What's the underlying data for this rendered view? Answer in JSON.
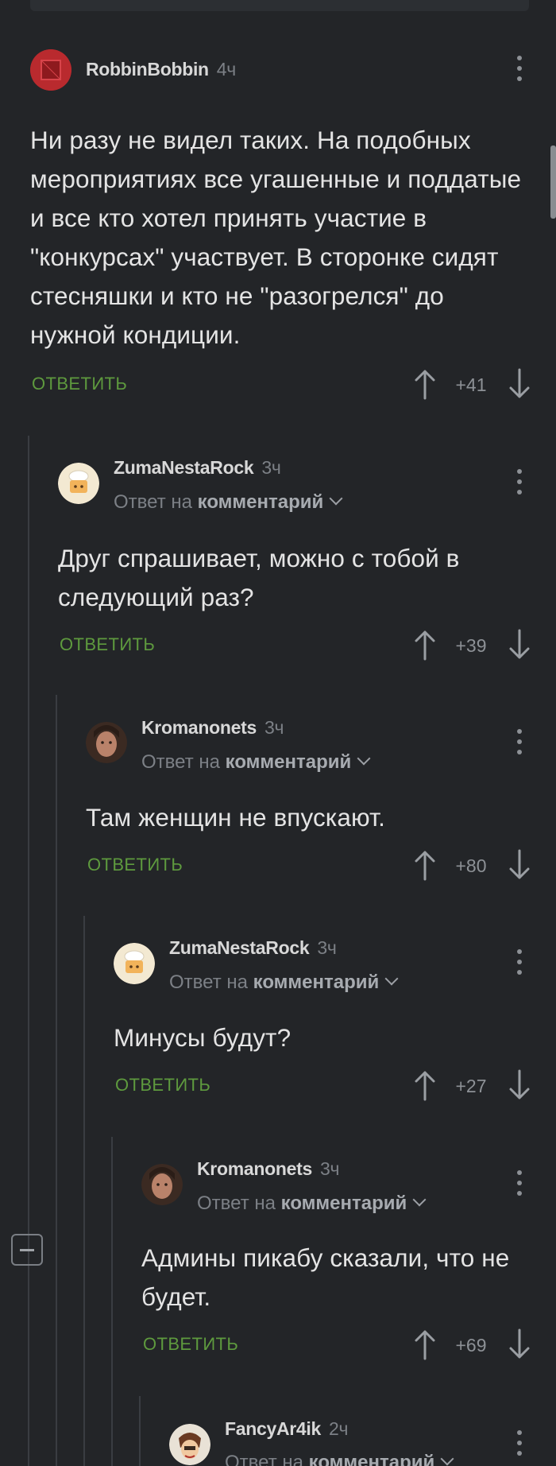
{
  "comments": [
    {
      "author": "RobbinBobbin",
      "time": "4ч",
      "reply_to": null,
      "text": "Ни разу не видел таких. На подобных мероприятиях все угашенные и поддатые и все кто хотел принять участие в \"конкурсах\" участвует. В сторонке сидят стесняшки и кто не \"разогрелся\" до нужной кондиции.",
      "reply_label": "ОТВЕТИТЬ",
      "score": "+41",
      "avatar": "red-square-avatar"
    },
    {
      "author": "ZumaNestaRock",
      "time": "3ч",
      "reply_prefix": "Ответ на",
      "reply_target": "комментарий",
      "text": "Друг спрашивает, можно с тобой в следующий раз?",
      "reply_label": "ОТВЕТИТЬ",
      "score": "+39",
      "avatar": "chef-hat-avatar"
    },
    {
      "author": "Kromanonets",
      "time": "3ч",
      "reply_prefix": "Ответ на",
      "reply_target": "комментарий",
      "text": "Там женщин не впускают.",
      "reply_label": "ОТВЕТИТЬ",
      "score": "+80",
      "avatar": "portrait-avatar"
    },
    {
      "author": "ZumaNestaRock",
      "time": "3ч",
      "reply_prefix": "Ответ на",
      "reply_target": "комментарий",
      "text": "Минусы будут?",
      "reply_label": "ОТВЕТИТЬ",
      "score": "+27",
      "avatar": "chef-hat-avatar"
    },
    {
      "author": "Kromanonets",
      "time": "3ч",
      "reply_prefix": "Ответ на",
      "reply_target": "комментарий",
      "text": "Админы пикабу сказали, что не будет.",
      "reply_label": "ОТВЕТИТЬ",
      "score": "+69",
      "avatar": "portrait-avatar"
    },
    {
      "author": "FancyAr4ik",
      "time": "2ч",
      "reply_prefix": "Ответ на",
      "reply_target": "комментарий",
      "avatar": "cartoon-avatar"
    }
  ],
  "colors": {
    "background": "#232528",
    "reply_green": "#5e9a3e",
    "muted": "#7c8086"
  }
}
